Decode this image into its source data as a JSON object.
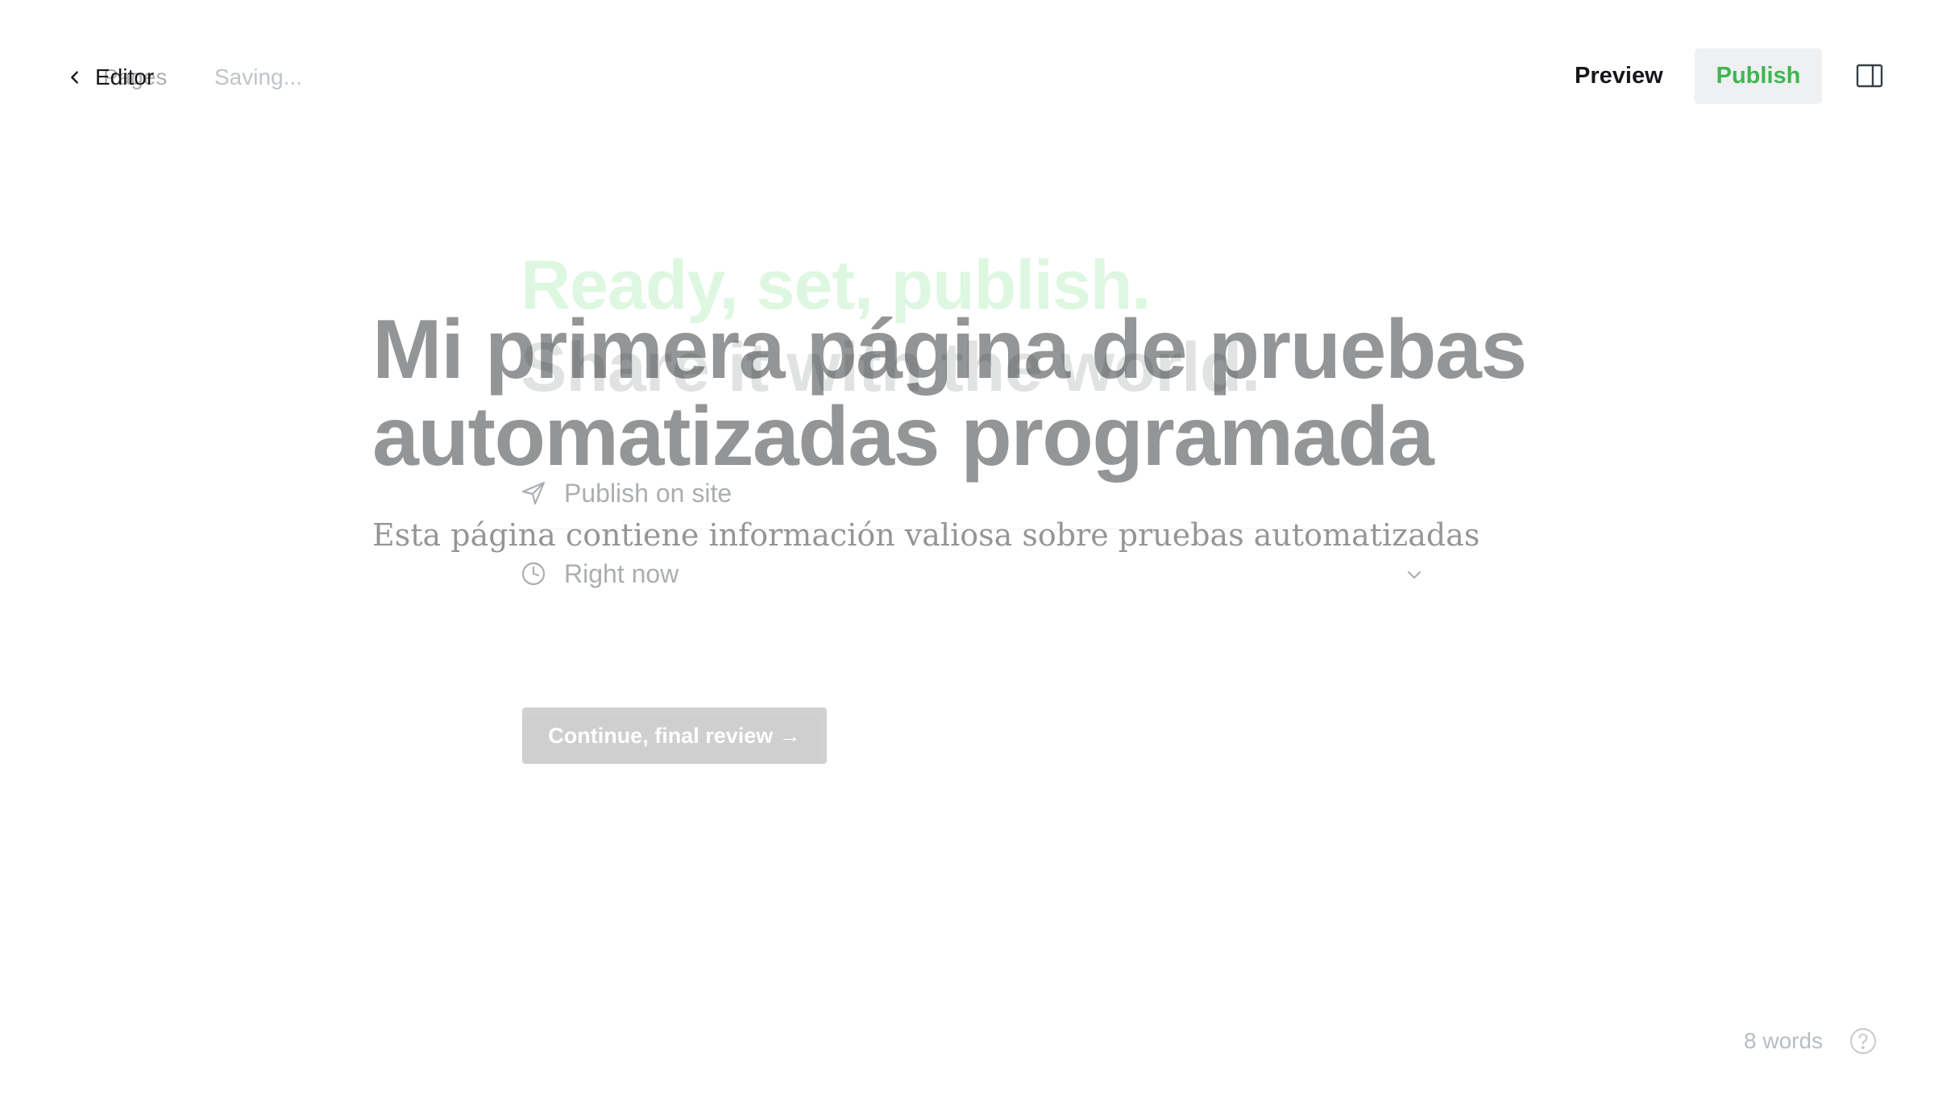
{
  "header": {
    "back_label": "Editor",
    "back_ghost_label": "Pages",
    "status": "Saving...",
    "preview_label": "Preview",
    "publish_label": "Publish"
  },
  "editor": {
    "title": "Mi primera página de pruebas automatizadas programada",
    "excerpt": "Esta página contiene información valiosa sobre pruebas automatizadas"
  },
  "publish_flow": {
    "heading_line1": "Ready, set, publish.",
    "heading_line2": "Share it with the world.",
    "publish_target": "Publish on site",
    "publish_time": "Right now",
    "continue_label": "Continue, final review →"
  },
  "footer": {
    "word_count": "8 words"
  },
  "colors": {
    "accent": "#30cf43",
    "text": "#15171a",
    "muted": "#b8bdc2",
    "publish_bg": "#eef0f2"
  },
  "icons": {
    "back": "chevron-left-icon",
    "sidebar": "sidebar-toggle-icon",
    "publish_target": "send-icon",
    "publish_time": "clock-icon",
    "dropdown": "chevron-down-icon",
    "help": "help-circle-icon"
  }
}
